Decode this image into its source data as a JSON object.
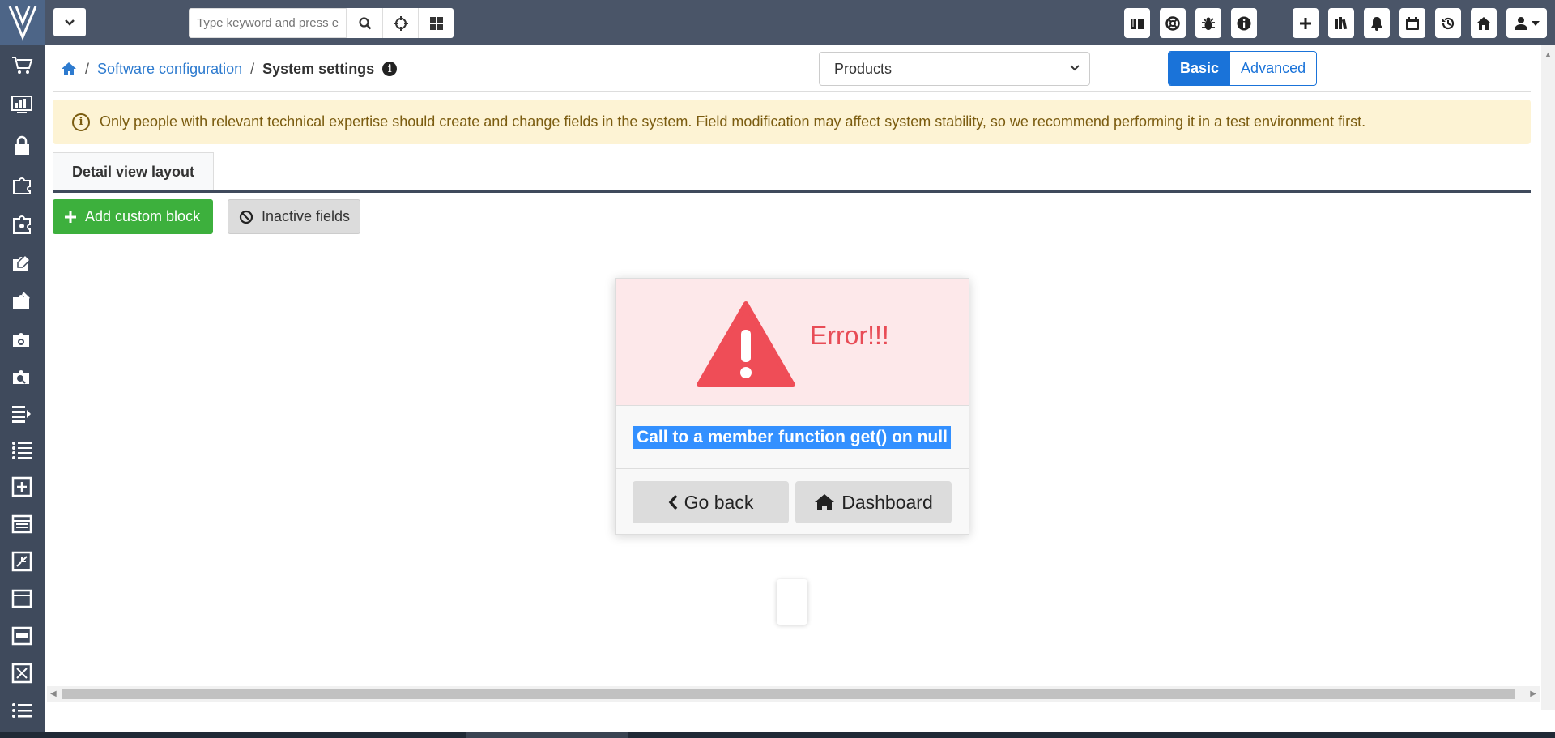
{
  "topbar": {
    "search_placeholder": "Type keyword and press e",
    "icons": [
      "book-icon",
      "life-ring-icon",
      "bug-icon",
      "info-icon",
      "plus-icon",
      "library-icon",
      "bell-icon",
      "calendar-icon",
      "history-icon",
      "home-icon",
      "user-icon"
    ]
  },
  "sidebar": {
    "icons": [
      "logo-icon",
      "cart-icon",
      "monitor-chart-icon",
      "lock-icon",
      "puzzle-icon",
      "puzzle-settings-icon",
      "puzzle-edit-icon",
      "puzzle-brush-icon",
      "puzzle-gear-icon",
      "puzzle-search-icon",
      "list-edit-icon",
      "list-icon",
      "plus-square-icon",
      "table-icon",
      "compress-icon",
      "folder-icon",
      "window-icon",
      "box-x-icon",
      "bullet-list-icon"
    ]
  },
  "breadcrumb": {
    "home": "home-icon",
    "parent": "Software configuration",
    "current": "System settings"
  },
  "module_select": {
    "value": "Products"
  },
  "mode_toggle": {
    "basic": "Basic",
    "advanced": "Advanced"
  },
  "alert": {
    "text": "Only people with relevant technical expertise should create and change fields in the system. Field modification may affect system stability, so we recommend performing it in a test environment first."
  },
  "tabs": [
    {
      "label": "Detail view layout"
    }
  ],
  "actions": {
    "add_custom_block": "Add custom block",
    "inactive_fields": "Inactive fields"
  },
  "error_modal": {
    "title": "Error!!!",
    "message": "Call to a member function get() on null",
    "go_back": "Go back",
    "dashboard": "Dashboard"
  },
  "colors": {
    "sidebar": "#3f4a5c",
    "topbar": "#4a5568",
    "accent": "#1a73d9",
    "success": "#3db03d",
    "error": "#e84c56",
    "alert_bg": "#fdf3d4"
  }
}
